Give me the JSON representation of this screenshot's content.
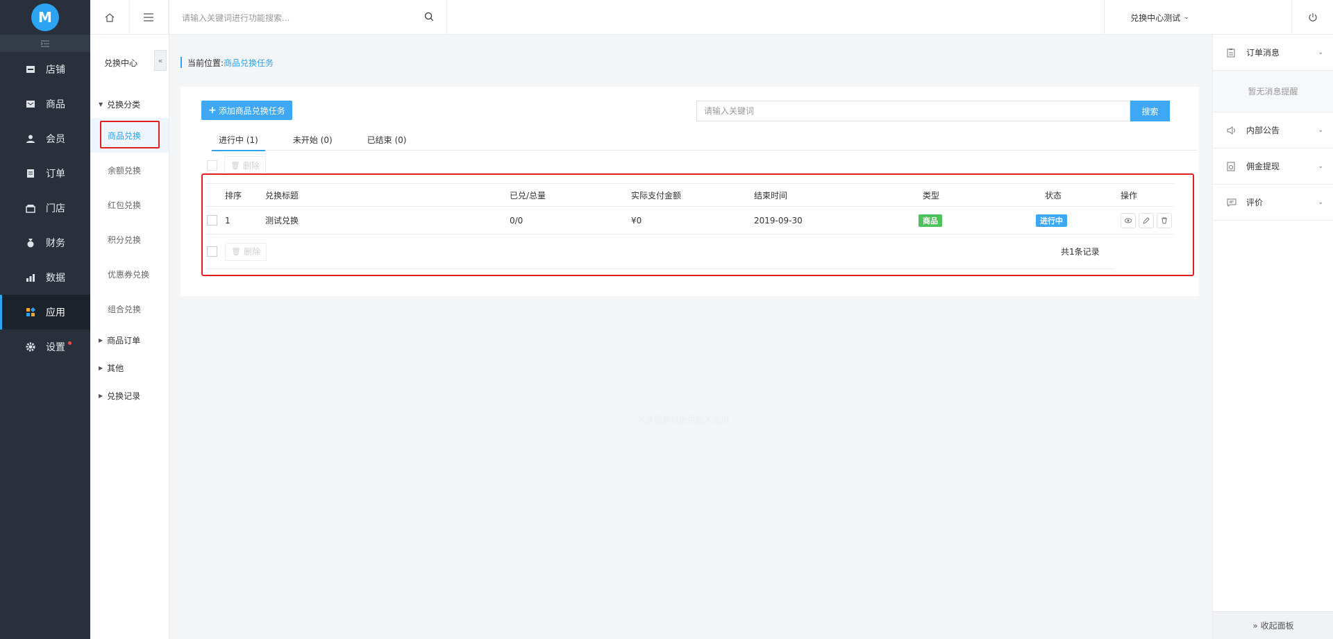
{
  "logo": {
    "letter": "M"
  },
  "sidebar": {
    "items": [
      {
        "label": "店铺",
        "icon": "store-icon"
      },
      {
        "label": "商品",
        "icon": "goods-icon"
      },
      {
        "label": "会员",
        "icon": "member-icon"
      },
      {
        "label": "订单",
        "icon": "order-icon"
      },
      {
        "label": "门店",
        "icon": "shop-icon"
      },
      {
        "label": "财务",
        "icon": "finance-icon"
      },
      {
        "label": "数据",
        "icon": "chart-icon"
      },
      {
        "label": "应用",
        "icon": "apps-icon",
        "active": true
      },
      {
        "label": "设置",
        "icon": "gear-icon",
        "dot": true
      }
    ]
  },
  "subnav": {
    "title": "兑换中心",
    "groups": [
      {
        "label": "兑换分类",
        "expanded": true
      },
      {
        "label": "商品订单"
      },
      {
        "label": "其他"
      },
      {
        "label": "兑换记录"
      }
    ],
    "items": [
      "商品兑换",
      "余额兑换",
      "红包兑换",
      "积分兑换",
      "优惠券兑换",
      "组合兑换"
    ],
    "active_item": "商品兑换"
  },
  "topbar": {
    "search_placeholder": "请输入关键词进行功能搜索...",
    "user": "兑换中心测试"
  },
  "breadcrumb": {
    "prefix": "当前位置:",
    "current": "商品兑换任务"
  },
  "toolbar": {
    "add_label": "添加商品兑换任务",
    "keyword_placeholder": "请输入关键词",
    "search_label": "搜索",
    "delete_label": "删除"
  },
  "tabs": [
    "进行中 (1)",
    "未开始 (0)",
    "已结束 (0)"
  ],
  "table": {
    "columns": [
      "排序",
      "兑换标题",
      "已兑/总量",
      "实际支付金额",
      "结束时间",
      "类型",
      "状态",
      "操作"
    ],
    "rows": [
      {
        "sort": "1",
        "title": "测试兑换",
        "ratio": "0/0",
        "amount": "¥0",
        "end": "2019-09-30",
        "type": "商品",
        "status": "进行中"
      }
    ],
    "total_text": "共1条记录"
  },
  "footer_note": "米多融商城提供技术支持",
  "colors": {
    "accent": "#2ba4f3",
    "type_badge": "#4cc25a",
    "status_badge": "#3fa8f4",
    "highlight": "#e02020"
  },
  "right_panel": {
    "sections": [
      {
        "label": "订单消息",
        "icon": "clipboard-icon"
      },
      {
        "label": "内部公告",
        "icon": "speaker-icon"
      },
      {
        "label": "佣金提现",
        "icon": "wallet-icon"
      },
      {
        "label": "评价",
        "icon": "comment-icon"
      }
    ],
    "empty_text": "暂无消息提醒",
    "collapse_label": "» 收起面板"
  }
}
